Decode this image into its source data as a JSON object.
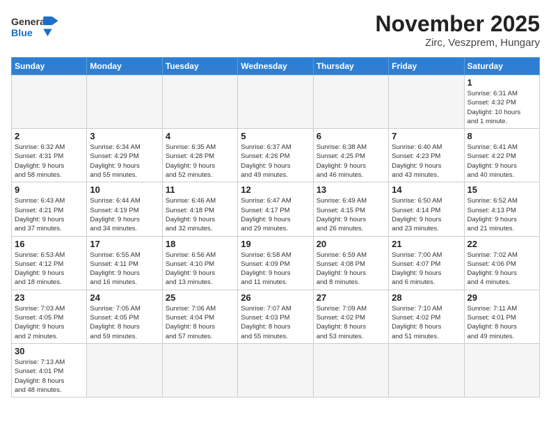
{
  "header": {
    "logo_general": "General",
    "logo_blue": "Blue",
    "title": "November 2025",
    "subtitle": "Zirc, Veszprem, Hungary"
  },
  "calendar": {
    "days_of_week": [
      "Sunday",
      "Monday",
      "Tuesday",
      "Wednesday",
      "Thursday",
      "Friday",
      "Saturday"
    ],
    "weeks": [
      [
        {
          "day": "",
          "info": ""
        },
        {
          "day": "",
          "info": ""
        },
        {
          "day": "",
          "info": ""
        },
        {
          "day": "",
          "info": ""
        },
        {
          "day": "",
          "info": ""
        },
        {
          "day": "",
          "info": ""
        },
        {
          "day": "1",
          "info": "Sunrise: 6:31 AM\nSunset: 4:32 PM\nDaylight: 10 hours\nand 1 minute."
        }
      ],
      [
        {
          "day": "2",
          "info": "Sunrise: 6:32 AM\nSunset: 4:31 PM\nDaylight: 9 hours\nand 58 minutes."
        },
        {
          "day": "3",
          "info": "Sunrise: 6:34 AM\nSunset: 4:29 PM\nDaylight: 9 hours\nand 55 minutes."
        },
        {
          "day": "4",
          "info": "Sunrise: 6:35 AM\nSunset: 4:28 PM\nDaylight: 9 hours\nand 52 minutes."
        },
        {
          "day": "5",
          "info": "Sunrise: 6:37 AM\nSunset: 4:26 PM\nDaylight: 9 hours\nand 49 minutes."
        },
        {
          "day": "6",
          "info": "Sunrise: 6:38 AM\nSunset: 4:25 PM\nDaylight: 9 hours\nand 46 minutes."
        },
        {
          "day": "7",
          "info": "Sunrise: 6:40 AM\nSunset: 4:23 PM\nDaylight: 9 hours\nand 43 minutes."
        },
        {
          "day": "8",
          "info": "Sunrise: 6:41 AM\nSunset: 4:22 PM\nDaylight: 9 hours\nand 40 minutes."
        }
      ],
      [
        {
          "day": "9",
          "info": "Sunrise: 6:43 AM\nSunset: 4:21 PM\nDaylight: 9 hours\nand 37 minutes."
        },
        {
          "day": "10",
          "info": "Sunrise: 6:44 AM\nSunset: 4:19 PM\nDaylight: 9 hours\nand 34 minutes."
        },
        {
          "day": "11",
          "info": "Sunrise: 6:46 AM\nSunset: 4:18 PM\nDaylight: 9 hours\nand 32 minutes."
        },
        {
          "day": "12",
          "info": "Sunrise: 6:47 AM\nSunset: 4:17 PM\nDaylight: 9 hours\nand 29 minutes."
        },
        {
          "day": "13",
          "info": "Sunrise: 6:49 AM\nSunset: 4:15 PM\nDaylight: 9 hours\nand 26 minutes."
        },
        {
          "day": "14",
          "info": "Sunrise: 6:50 AM\nSunset: 4:14 PM\nDaylight: 9 hours\nand 23 minutes."
        },
        {
          "day": "15",
          "info": "Sunrise: 6:52 AM\nSunset: 4:13 PM\nDaylight: 9 hours\nand 21 minutes."
        }
      ],
      [
        {
          "day": "16",
          "info": "Sunrise: 6:53 AM\nSunset: 4:12 PM\nDaylight: 9 hours\nand 18 minutes."
        },
        {
          "day": "17",
          "info": "Sunrise: 6:55 AM\nSunset: 4:11 PM\nDaylight: 9 hours\nand 16 minutes."
        },
        {
          "day": "18",
          "info": "Sunrise: 6:56 AM\nSunset: 4:10 PM\nDaylight: 9 hours\nand 13 minutes."
        },
        {
          "day": "19",
          "info": "Sunrise: 6:58 AM\nSunset: 4:09 PM\nDaylight: 9 hours\nand 11 minutes."
        },
        {
          "day": "20",
          "info": "Sunrise: 6:59 AM\nSunset: 4:08 PM\nDaylight: 9 hours\nand 8 minutes."
        },
        {
          "day": "21",
          "info": "Sunrise: 7:00 AM\nSunset: 4:07 PM\nDaylight: 9 hours\nand 6 minutes."
        },
        {
          "day": "22",
          "info": "Sunrise: 7:02 AM\nSunset: 4:06 PM\nDaylight: 9 hours\nand 4 minutes."
        }
      ],
      [
        {
          "day": "23",
          "info": "Sunrise: 7:03 AM\nSunset: 4:05 PM\nDaylight: 9 hours\nand 2 minutes."
        },
        {
          "day": "24",
          "info": "Sunrise: 7:05 AM\nSunset: 4:05 PM\nDaylight: 8 hours\nand 59 minutes."
        },
        {
          "day": "25",
          "info": "Sunrise: 7:06 AM\nSunset: 4:04 PM\nDaylight: 8 hours\nand 57 minutes."
        },
        {
          "day": "26",
          "info": "Sunrise: 7:07 AM\nSunset: 4:03 PM\nDaylight: 8 hours\nand 55 minutes."
        },
        {
          "day": "27",
          "info": "Sunrise: 7:09 AM\nSunset: 4:02 PM\nDaylight: 8 hours\nand 53 minutes."
        },
        {
          "day": "28",
          "info": "Sunrise: 7:10 AM\nSunset: 4:02 PM\nDaylight: 8 hours\nand 51 minutes."
        },
        {
          "day": "29",
          "info": "Sunrise: 7:11 AM\nSunset: 4:01 PM\nDaylight: 8 hours\nand 49 minutes."
        }
      ],
      [
        {
          "day": "30",
          "info": "Sunrise: 7:13 AM\nSunset: 4:01 PM\nDaylight: 8 hours\nand 48 minutes."
        },
        {
          "day": "",
          "info": ""
        },
        {
          "day": "",
          "info": ""
        },
        {
          "day": "",
          "info": ""
        },
        {
          "day": "",
          "info": ""
        },
        {
          "day": "",
          "info": ""
        },
        {
          "day": "",
          "info": ""
        }
      ]
    ]
  }
}
